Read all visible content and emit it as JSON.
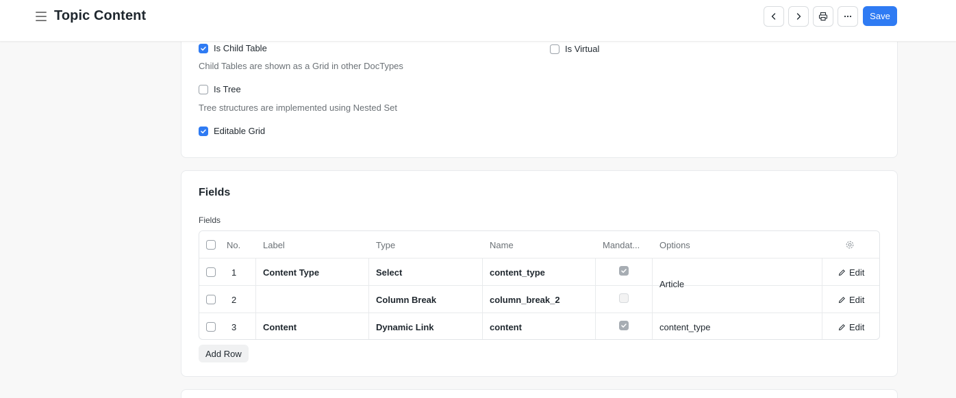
{
  "header": {
    "title": "Topic Content",
    "save_label": "Save"
  },
  "settings": {
    "is_child_table": {
      "label": "Is Child Table",
      "checked": true,
      "help": "Child Tables are shown as a Grid in other DocTypes"
    },
    "is_virtual": {
      "label": "Is Virtual",
      "checked": false
    },
    "is_tree": {
      "label": "Is Tree",
      "checked": false,
      "help": "Tree structures are implemented using Nested Set"
    },
    "editable_grid": {
      "label": "Editable Grid",
      "checked": true
    }
  },
  "fields_section": {
    "title": "Fields",
    "label": "Fields",
    "columns": {
      "no": "No.",
      "label": "Label",
      "type": "Type",
      "name": "Name",
      "mandatory": "Mandat...",
      "options": "Options"
    },
    "rows": [
      {
        "no": "1",
        "label": "Content Type",
        "type": "Select",
        "name": "content_type",
        "mandatory": true,
        "options": "Article",
        "edit": "Edit"
      },
      {
        "no": "2",
        "label": "",
        "type": "Column Break",
        "name": "column_break_2",
        "mandatory": false,
        "options": "",
        "edit": "Edit"
      },
      {
        "no": "3",
        "label": "Content",
        "type": "Dynamic Link",
        "name": "content",
        "mandatory": true,
        "options": "content_type",
        "edit": "Edit"
      }
    ],
    "add_row_label": "Add Row"
  },
  "colors": {
    "primary": "#2f7bf3",
    "text": "#1f272e",
    "muted": "#6b7176"
  }
}
